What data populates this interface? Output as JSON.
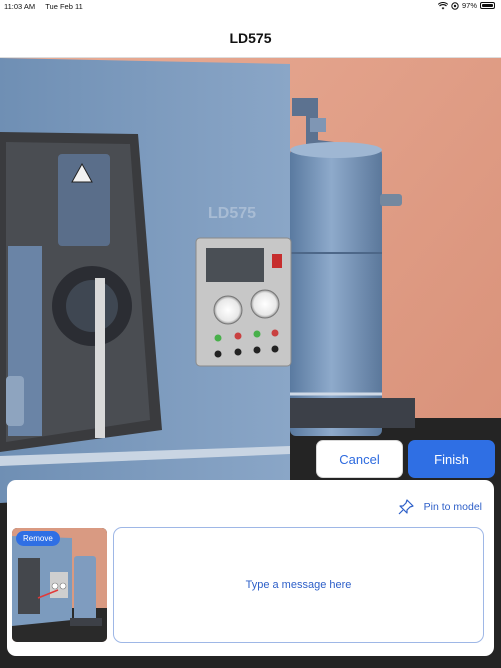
{
  "status_bar": {
    "time": "11:03 AM",
    "date": "Tue Feb 11",
    "battery": "97%",
    "battery_level": 0.97
  },
  "header": {
    "title": "LD575"
  },
  "scene": {
    "machine_label": "LD575"
  },
  "actions": {
    "cancel_label": "Cancel",
    "finish_label": "Finish"
  },
  "annotation": {
    "pin_label": "Pin to model",
    "remove_label": "Remove",
    "message_placeholder": "Type a message here"
  },
  "colors": {
    "accent": "#2f6fe4",
    "accent_text": "#2d5fc8",
    "wall": "#e8a48c",
    "machine": "#7c9bbe"
  },
  "icons": {
    "wifi": "wifi-icon",
    "location": "location-icon",
    "battery": "battery-icon",
    "pin": "pin-icon"
  }
}
